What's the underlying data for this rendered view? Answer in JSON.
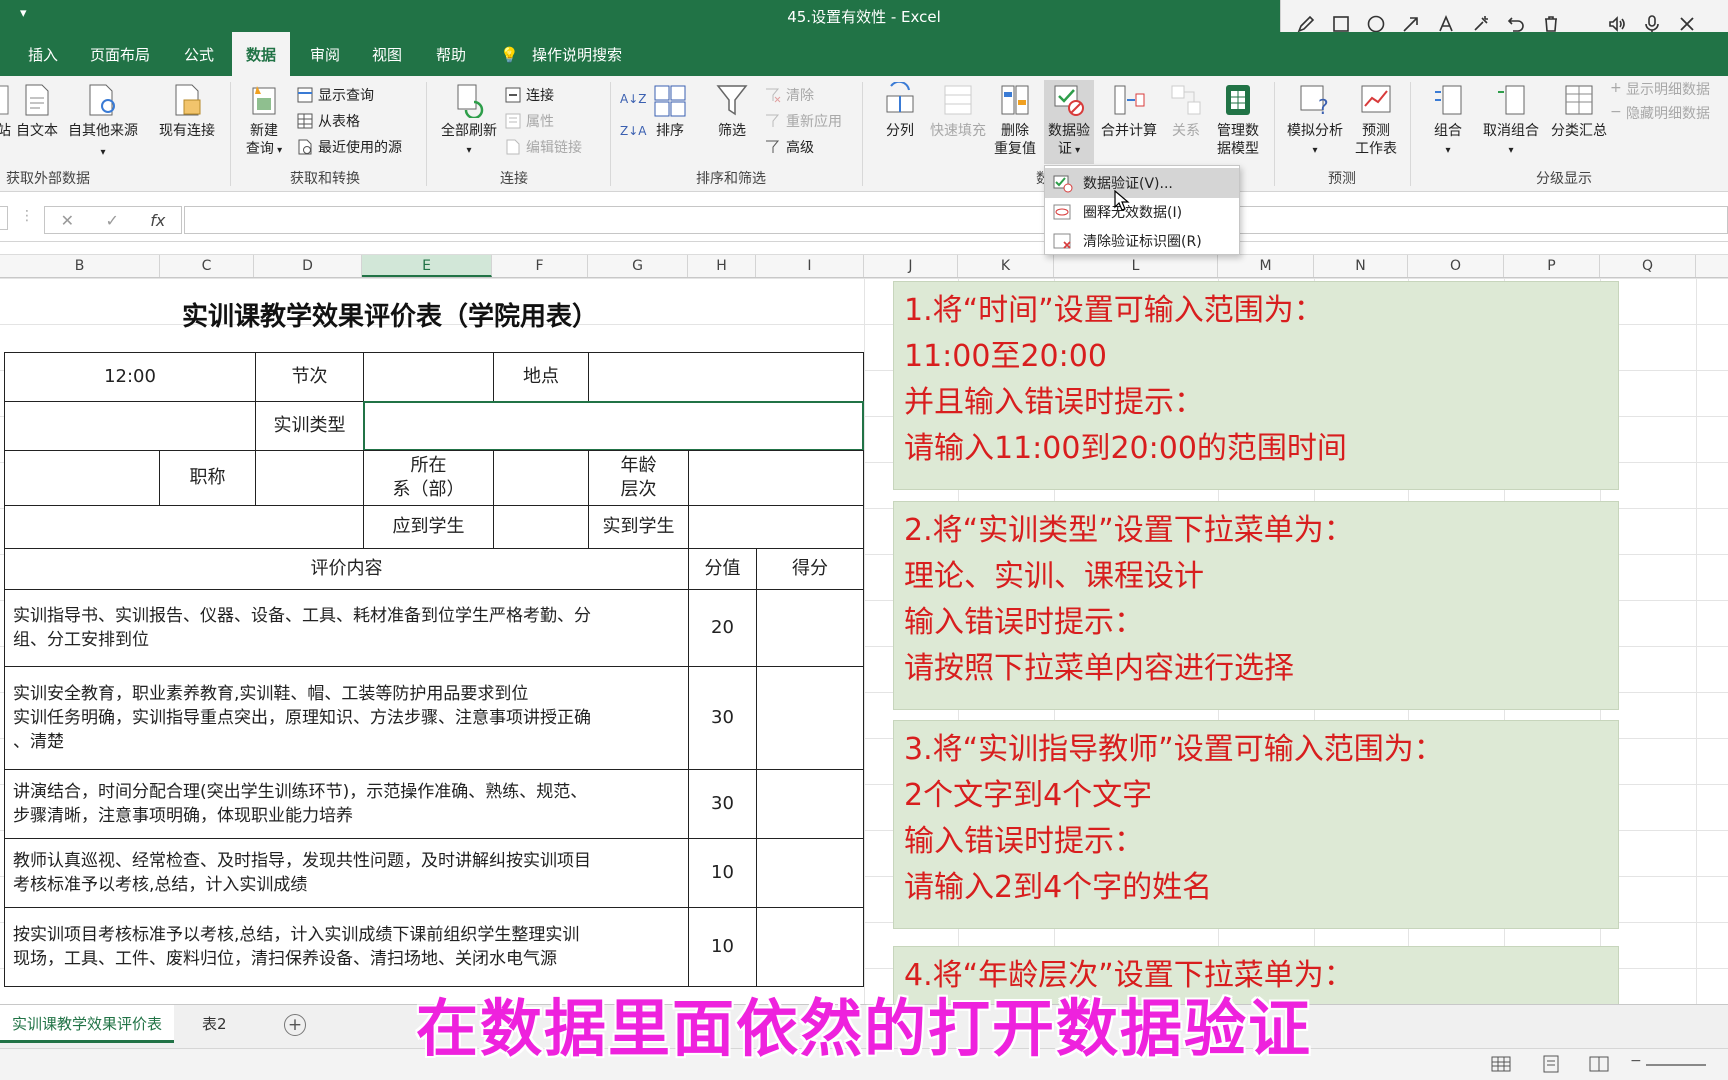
{
  "window": {
    "title": "45.设置有效性  -  Excel",
    "qat_glyph": "▾"
  },
  "annotation_toolbar": [
    "pen-icon",
    "rectangle-icon",
    "circle-icon",
    "arrow-icon",
    "text-icon",
    "highlighter-icon",
    "undo-icon",
    "trash-icon",
    "speaker-icon",
    "microphone-icon",
    "close-icon"
  ],
  "tabs": [
    "插入",
    "页面布局",
    "公式",
    "数据",
    "审阅",
    "视图",
    "帮助",
    "操作说明搜索"
  ],
  "active_tab": "数据",
  "ribbon": {
    "group1": {
      "btn_partial": "站",
      "btn_text": "自文本",
      "btn_other": "自其他来源",
      "btn_existing": "现有连接",
      "label": "获取外部数据"
    },
    "group2": {
      "btn_newquery": "新建",
      "btn_newquery2": "查询",
      "s_show": "显示查询",
      "s_table": "从表格",
      "s_recent": "最近使用的源",
      "label": "获取和转换"
    },
    "group3": {
      "btn_refresh": "全部刷新",
      "s_conn": "连接",
      "s_prop": "属性",
      "s_edit": "编辑链接",
      "label": "连接"
    },
    "group4": {
      "s_asc": "A↓Z",
      "s_desc": "Z↓A",
      "btn_sort": "排序",
      "btn_filter": "筛选",
      "s_clear": "清除",
      "s_reapply": "重新应用",
      "s_adv": "高级",
      "label": "排序和筛选"
    },
    "group5": {
      "btn_split": "分列",
      "btn_flash": "快速填充",
      "btn_del1": "删除",
      "btn_del2": "重复值",
      "btn_dv1": "数据验",
      "btn_dv2": "证",
      "btn_consol": "合并计算",
      "btn_rel": "关系",
      "btn_model1": "管理数",
      "btn_model2": "据模型",
      "label": "数"
    },
    "group6": {
      "btn_whatif": "模拟分析",
      "btn_fc1": "预测",
      "btn_fc2": "工作表",
      "label": "预测"
    },
    "group7": {
      "btn_group": "组合",
      "btn_ungroup": "取消组合",
      "btn_subtotal": "分类汇总",
      "s_show": "显示明细数据",
      "s_hide": "隐藏明细数据",
      "label": "分级显示"
    }
  },
  "dv_menu": {
    "items": [
      "数据验证(V)...",
      "圈释无效数据(I)",
      "清除验证标识圈(R)"
    ]
  },
  "formula_bar": {
    "cancel": "✕",
    "confirm": "✓",
    "fx": "fx",
    "value": ""
  },
  "columns": [
    "B",
    "C",
    "D",
    "E",
    "F",
    "G",
    "H",
    "I",
    "J",
    "K",
    "L",
    "M",
    "N",
    "O",
    "P",
    "Q"
  ],
  "selected_column": "E",
  "sheet": {
    "title": "实训课教学效果评价表（学院用表）",
    "time": "12:00",
    "jieci": "节次",
    "didian": "地点",
    "shixun_leixing": "实训类型",
    "zhicheng": "职称",
    "suozai1": "所在",
    "suozai2": "系（部）",
    "nianling1": "年龄",
    "nianling2": "层次",
    "yingdao": "应到学生",
    "shidao": "实到学生",
    "pingjia": "评价内容",
    "fenzhi": "分值",
    "defen": "得分",
    "rows": [
      {
        "content": [
          "实训指导书、实训报告、仪器、设备、工具、耗材准备到位学生严格考勤、分",
          "组、分工安排到位"
        ],
        "score": "20"
      },
      {
        "content": [
          "实训安全教育，职业素养教育,实训鞋、帽、工装等防护用品要求到位",
          "实训任务明确，实训指导重点突出，原理知识、方法步骤、注意事项讲授正确",
          "、清楚"
        ],
        "score": "30"
      },
      {
        "content": [
          "讲演结合，时间分配合理(突出学生训练环节)，示范操作准确、熟练、规范、",
          "步骤清晰，注意事项明确，体现职业能力培养"
        ],
        "score": "30"
      },
      {
        "content": [
          "教师认真巡视、经常检查、及时指导，发现共性问题，及时讲解纠按实训项目",
          "考核标准予以考核,总结，计入实训成绩"
        ],
        "score": "10"
      },
      {
        "content": [
          "按实训项目考核标准予以考核,总结，计入实训成绩下课前组织学生整理实训",
          "现场，工具、工件、废料归位，清扫保养设备、清扫场地、关闭水电气源"
        ],
        "score": "10"
      }
    ]
  },
  "instructions": [
    [
      "1.将“时间”设置可输入范围为：",
      "11:00至20:00",
      "并且输入错误时提示：",
      "请输入11:00到20:00的范围时间"
    ],
    [
      "2.将“实训类型”设置下拉菜单为：",
      "理论、实训、课程设计",
      "输入错误时提示：",
      "请按照下拉菜单内容进行选择"
    ],
    [
      "3.将“实训指导教师”设置可输入范围为：",
      "2个文字到4个文字",
      "输入错误时提示：",
      "请输入2到4个字的姓名"
    ],
    [
      "4.将“年龄层次”设置下拉菜单为："
    ]
  ],
  "sheet_tabs": {
    "active": "实训课教学效果评价表",
    "other": "表2",
    "add": "+"
  },
  "subtitle": "在数据里面依然的打开数据验证",
  "colors": {
    "excel_green": "#217346",
    "instruction_red": "#d81e1e",
    "instruction_bg": "#dde9d5",
    "subtitle": "#ee22dd"
  }
}
